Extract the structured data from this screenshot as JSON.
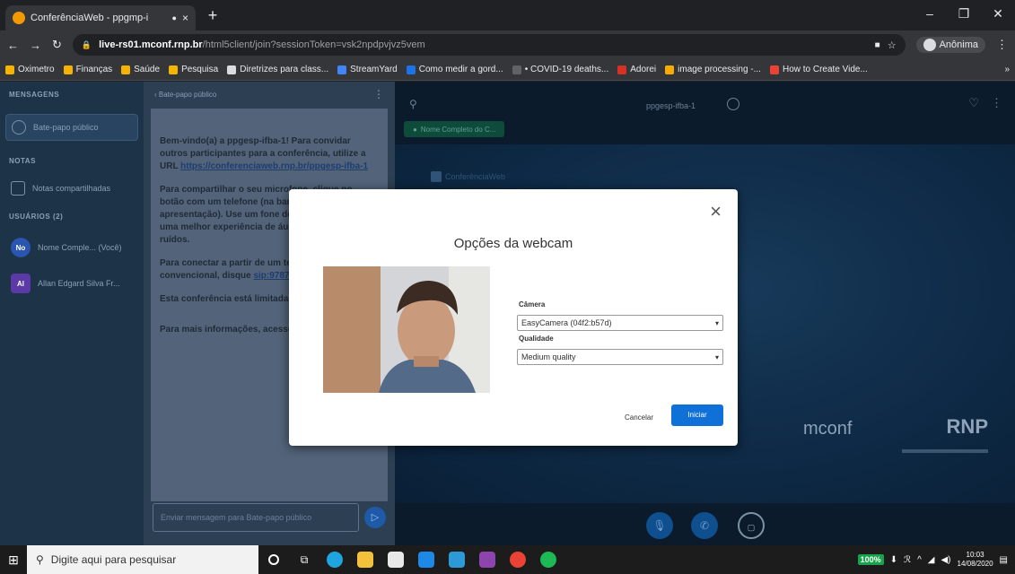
{
  "browser": {
    "tab_title": "ConferênciaWeb - ppgmp-i",
    "tab_close": "×",
    "new_tab": "+",
    "url_host": "live-rs01.mconf.rnp.br",
    "url_path": "/html5client/join?sessionToken=vsk2npdpvjvz5vem",
    "profile_label": "Anônima",
    "bookmarks": [
      {
        "label": "Oximetro",
        "color": "#f4b400"
      },
      {
        "label": "Finanças",
        "color": "#f4b400"
      },
      {
        "label": "Saúde",
        "color": "#f4b400"
      },
      {
        "label": "Pesquisa",
        "color": "#f4b400"
      },
      {
        "label": "Diretrizes para class...",
        "color": "#dadce0"
      },
      {
        "label": "StreamYard",
        "color": "#4285f4"
      },
      {
        "label": "Como medir a gord...",
        "color": "#1a73e8"
      },
      {
        "label": "• COVID-19 deaths...",
        "color": "#5f6368"
      },
      {
        "label": "Adorei",
        "color": "#d93025"
      },
      {
        "label": "image processing -...",
        "color": "#f9ab00"
      },
      {
        "label": "How to Create Vide...",
        "color": "#ea4335"
      }
    ],
    "bookmarks_more": "»"
  },
  "sidebar": {
    "messages_heading": "MENSAGENS",
    "public_chat_label": "Bate-papo público",
    "notes_heading": "NOTAS",
    "shared_notes_label": "Notas compartilhadas",
    "users_heading": "USUÁRIOS (2)",
    "users": [
      {
        "initials": "No",
        "name": "Nome Comple... (Você)",
        "color": "#2a55b0"
      },
      {
        "initials": "Al",
        "name": "Allan Edgard Silva Fr...",
        "color": "#5b3aa8"
      }
    ]
  },
  "chat": {
    "header": "‹ Bate-papo público",
    "welcome_1": "Bem-vindo(a) a ppgesp-ifba-1! Para convidar outros participantes para a conferência, utilize a URL",
    "welcome_link": "https://conferenciaweb.rnp.br/ppgesp-ifba-1",
    "paragraph_2": "Para compartilhar o seu microfone, clique no botão com um telefone (na barra inferior, abaixo da apresentação). Use um fone de ouvido para ter uma melhor experiência de áudio, sem eco e ruídos.",
    "paragraph_3_prefix": "Para conectar a partir de um telefone convencional, disque ",
    "paragraph_3_link": "sip:97879@sip.mconf.rnp.br",
    "paragraph_4": "Esta conferência está limitada a 75 participantes.",
    "paragraph_5": "Para mais informações, acesse",
    "input_placeholder": "Enviar mensagem para Bate-papo público"
  },
  "stage": {
    "title": "ppgesp-ifba-1",
    "presenter": "Nome Completo do C...",
    "slide_brand": "ConferênciaWeb",
    "mconf_logo": "mconf",
    "rnp_logo": "RNP"
  },
  "modal": {
    "title": "Opções da webcam",
    "camera_label": "Câmera",
    "camera_value": "EasyCamera (04f2:b57d)",
    "quality_label": "Qualidade",
    "quality_value": "Medium quality",
    "cancel_label": "Cancelar",
    "start_label": "Iniciar",
    "close": "×"
  },
  "taskbar": {
    "search_placeholder": "Digite aqui para pesquisar",
    "battery": "100%",
    "time": "10:03",
    "date": "14/08/2020"
  }
}
